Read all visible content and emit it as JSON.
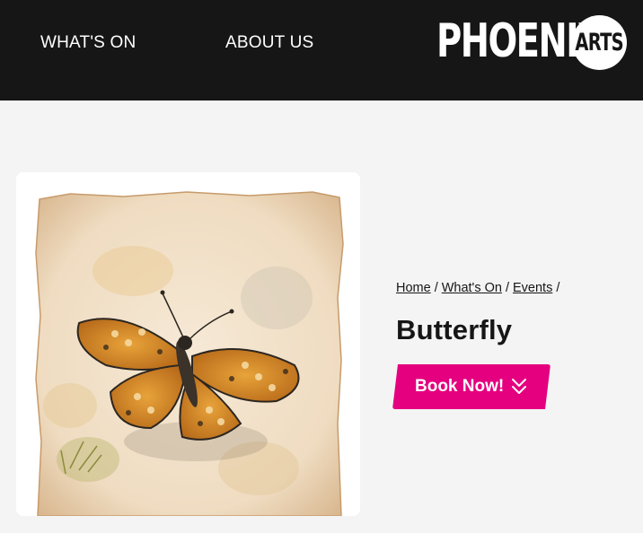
{
  "nav": {
    "items": [
      {
        "label": "WHAT'S ON"
      },
      {
        "label": "ABOUT US"
      }
    ]
  },
  "logo": {
    "word": "PHOENIX",
    "badge": "ARTS"
  },
  "breadcrumb": {
    "items": [
      {
        "label": "Home"
      },
      {
        "label": "What's On"
      },
      {
        "label": "Events"
      }
    ],
    "separator": "/"
  },
  "event": {
    "title": "Butterfly",
    "image_icon": "butterfly-illustration"
  },
  "cta": {
    "label": "Book Now!",
    "icon": "double-chevron-down-icon"
  },
  "colors": {
    "header_bg": "#161616",
    "page_bg": "#f4f4f4",
    "accent": "#e4007f",
    "text": "#161616"
  }
}
